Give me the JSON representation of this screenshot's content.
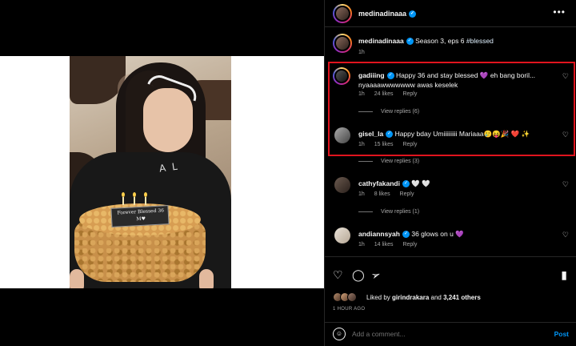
{
  "post": {
    "username": "medinadinaaa",
    "more_label": "•••",
    "next_label": "›",
    "caption_text": "Season 3, eps 6",
    "caption_hashtag": "#blessed",
    "caption_time": "1h",
    "cake_plaque": "Forever Blessed 36 M♥",
    "shirt_text": "A L"
  },
  "comments": [
    {
      "username": "gadiiing",
      "verified": true,
      "text": "Happy 36 and stay blessed 💜 eh bang boril... nyaaaawwwwwww awas keselek",
      "time": "1h",
      "likes": "24 likes",
      "reply_label": "Reply",
      "view_replies": "View replies (6)"
    },
    {
      "username": "gisel_la",
      "verified": true,
      "text": "Happy bday Umiiiiiiiii Mariaaa🥲😝🎉 ❤️ ✨",
      "time": "1h",
      "likes": "15 likes",
      "reply_label": "Reply",
      "view_replies": "View replies (3)"
    },
    {
      "username": "cathyfakandi",
      "verified": true,
      "text": "🤍 🤍",
      "time": "1h",
      "likes": "8 likes",
      "reply_label": "Reply",
      "view_replies": "View replies (1)"
    },
    {
      "username": "andiannsyah",
      "verified": true,
      "text": "36 glows on u 💜",
      "time": "1h",
      "likes": "14 likes",
      "reply_label": "Reply"
    }
  ],
  "actions": {
    "liked_by_prefix": "Liked by",
    "liked_by_user": "girindrakara",
    "liked_by_and": "and",
    "liked_by_others": "3,241 others",
    "posted_time": "1 HOUR AGO"
  },
  "add_comment": {
    "placeholder": "Add a comment...",
    "post_label": "Post"
  },
  "colors": {
    "accent": "#0095f6",
    "highlight_box": "#e0141e",
    "background": "#000000"
  }
}
